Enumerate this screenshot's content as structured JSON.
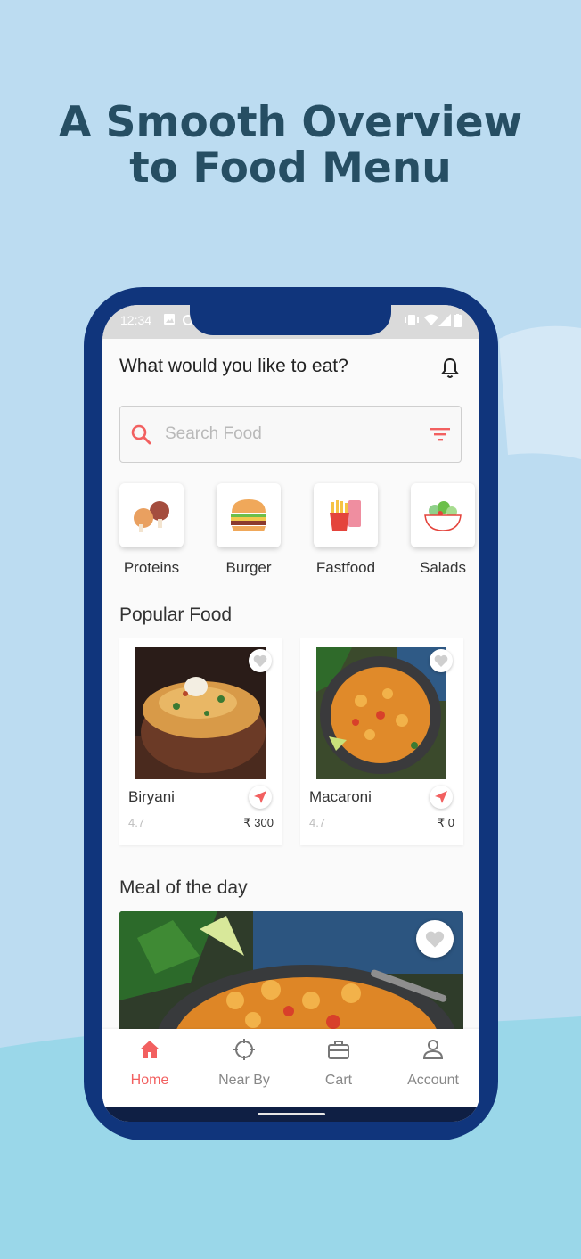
{
  "headline": {
    "line1": "A Smooth Overview",
    "line2": "to Food Menu"
  },
  "colors": {
    "accent": "#f26060",
    "phone_frame": "#10357c",
    "headline": "#264e63",
    "background": "#bcdcf1"
  },
  "status_bar": {
    "time": "12:34",
    "icons": [
      "image-icon",
      "sync-icon",
      "vibrate-icon",
      "wifi-icon",
      "signal-icon",
      "battery-icon"
    ]
  },
  "header": {
    "greeting": "What would you like to eat?",
    "icon": "bell-icon"
  },
  "search": {
    "placeholder": "Search Food",
    "icon": "search-icon",
    "filter_icon": "filter-icon"
  },
  "categories": [
    {
      "label": "Proteins",
      "icon": "chicken-leg-icon"
    },
    {
      "label": "Burger",
      "icon": "burger-icon"
    },
    {
      "label": "Fastfood",
      "icon": "fries-icon"
    },
    {
      "label": "Salads",
      "icon": "salad-bowl-icon"
    }
  ],
  "popular": {
    "title": "Popular Food",
    "items": [
      {
        "name": "Biryani",
        "rating": "4.7",
        "price": "₹ 300",
        "image": "biryani-photo"
      },
      {
        "name": "Macaroni",
        "rating": "4.7",
        "price": "₹ 0",
        "image": "macaroni-photo"
      }
    ]
  },
  "meal_of_day": {
    "title": "Meal of the day",
    "image": "macaroni-photo"
  },
  "bottom_nav": [
    {
      "label": "Home",
      "icon": "home-icon",
      "active": true
    },
    {
      "label": "Near By",
      "icon": "crosshair-icon",
      "active": false
    },
    {
      "label": "Cart",
      "icon": "briefcase-icon",
      "active": false
    },
    {
      "label": "Account",
      "icon": "person-icon",
      "active": false
    }
  ]
}
